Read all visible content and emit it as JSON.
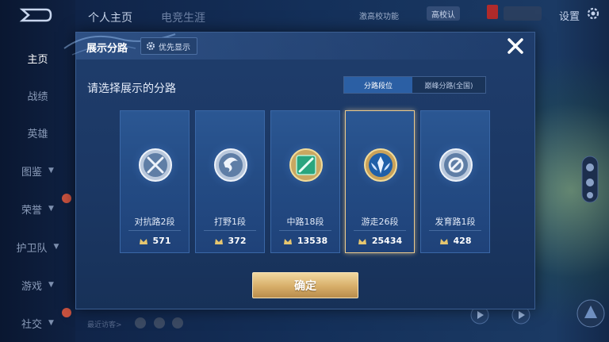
{
  "sidebar": {
    "items": [
      {
        "label": "主页",
        "active": true,
        "chevron": false
      },
      {
        "label": "战绩",
        "active": false,
        "chevron": false
      },
      {
        "label": "英雄",
        "active": false,
        "chevron": false
      },
      {
        "label": "图鉴",
        "active": false,
        "chevron": true
      },
      {
        "label": "荣誉",
        "active": false,
        "chevron": true
      },
      {
        "label": "护卫队",
        "active": false,
        "chevron": true
      },
      {
        "label": "游戏",
        "active": false,
        "chevron": true
      },
      {
        "label": "社交",
        "active": false,
        "chevron": true
      }
    ]
  },
  "topbar": {
    "tabs": [
      "个人主页",
      "电竞生涯"
    ],
    "right_text": "激高校功能",
    "pill": "高校认",
    "settings": "设置"
  },
  "bottom": {
    "recent_visitors": "最近访客>"
  },
  "modal": {
    "title": "展示分路",
    "priority_button": "优先显示",
    "subtitle": "请选择展示的分路",
    "toggle": {
      "options": [
        "分路段位",
        "巅峰分路(全国)"
      ],
      "active_index": 0
    },
    "cards": [
      {
        "label": "对抗路2段",
        "score": "571",
        "icon": "sword-clash-icon",
        "selected": false
      },
      {
        "label": "打野1段",
        "score": "372",
        "icon": "jungle-swirl-icon",
        "selected": false
      },
      {
        "label": "中路18段",
        "score": "13538",
        "icon": "mid-lane-icon",
        "selected": false
      },
      {
        "label": "游走26段",
        "score": "25434",
        "icon": "roam-wing-icon",
        "selected": true
      },
      {
        "label": "发育路1段",
        "score": "428",
        "icon": "farm-lane-icon",
        "selected": false
      }
    ],
    "confirm_label": "确定"
  },
  "colors": {
    "accent_gold": "#d7ae69",
    "toggle_active": "#2b5fa4",
    "card_bg": "#244c85"
  }
}
